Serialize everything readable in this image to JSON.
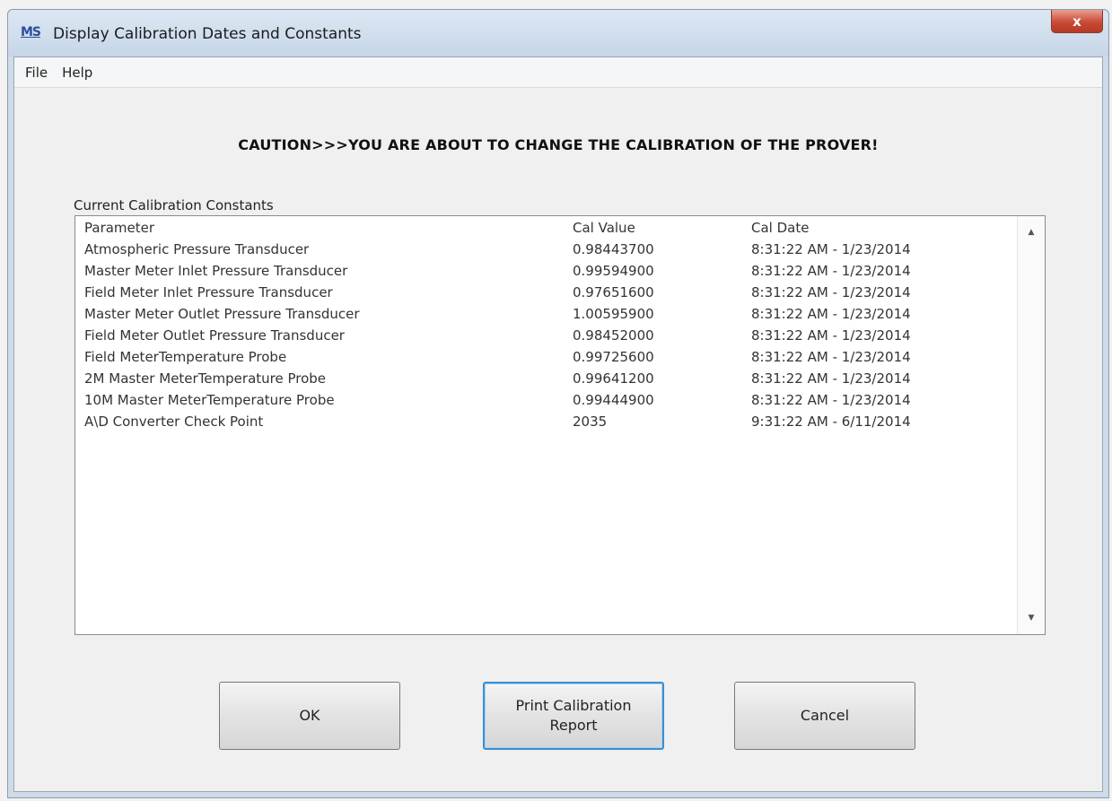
{
  "window": {
    "title": "Display Calibration Dates and Constants",
    "icon_text": "MS",
    "close_glyph": "x"
  },
  "menu": {
    "items": [
      "File",
      "Help"
    ]
  },
  "caution_text": "CAUTION>>>YOU ARE ABOUT TO CHANGE THE CALIBRATION OF THE PROVER!",
  "group_label": "Current Calibration Constants",
  "list": {
    "columns": [
      "Parameter",
      "Cal Value",
      "Cal Date"
    ],
    "rows": [
      [
        "Atmospheric Pressure Transducer",
        "0.98443700",
        "8:31:22 AM - 1/23/2014"
      ],
      [
        "Master Meter Inlet Pressure Transducer",
        "0.99594900",
        "8:31:22 AM - 1/23/2014"
      ],
      [
        "Field Meter Inlet Pressure Transducer",
        "0.97651600",
        "8:31:22 AM - 1/23/2014"
      ],
      [
        "Master Meter Outlet Pressure Transducer",
        "1.00595900",
        "8:31:22 AM - 1/23/2014"
      ],
      [
        "Field Meter Outlet Pressure Transducer",
        "0.98452000",
        "8:31:22 AM - 1/23/2014"
      ],
      [
        "Field MeterTemperature Probe",
        "0.99725600",
        "8:31:22 AM - 1/23/2014"
      ],
      [
        "2M Master MeterTemperature Probe",
        "0.99641200",
        "8:31:22 AM - 1/23/2014"
      ],
      [
        "10M Master MeterTemperature Probe",
        "0.99444900",
        "8:31:22 AM - 1/23/2014"
      ],
      [
        "A\\D Converter Check Point",
        "2035",
        "9:31:22 AM - 6/11/2014"
      ]
    ]
  },
  "buttons": {
    "ok": "OK",
    "print": "Print Calibration\nReport",
    "cancel": "Cancel"
  },
  "icons": {
    "scroll_up": "scroll-up-arrow",
    "scroll_down": "scroll-down-arrow"
  }
}
